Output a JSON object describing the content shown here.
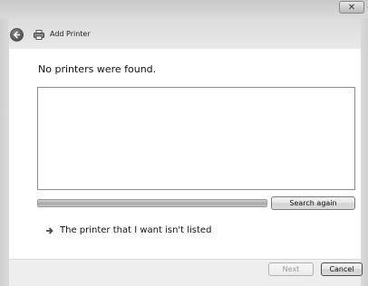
{
  "window": {
    "title": "Add Printer",
    "close_label": "✕"
  },
  "main": {
    "heading": "No printers were found.",
    "search_progress": 1.0,
    "search_again_label": "Search again",
    "missing_printer_link": "The printer that I want isn't listed"
  },
  "footer": {
    "next_label": "Next",
    "cancel_label": "Cancel"
  },
  "icons": {
    "back": "back-arrow-icon",
    "printer": "printer-icon",
    "link_arrow": "arrow-right-icon",
    "close": "close-icon"
  }
}
